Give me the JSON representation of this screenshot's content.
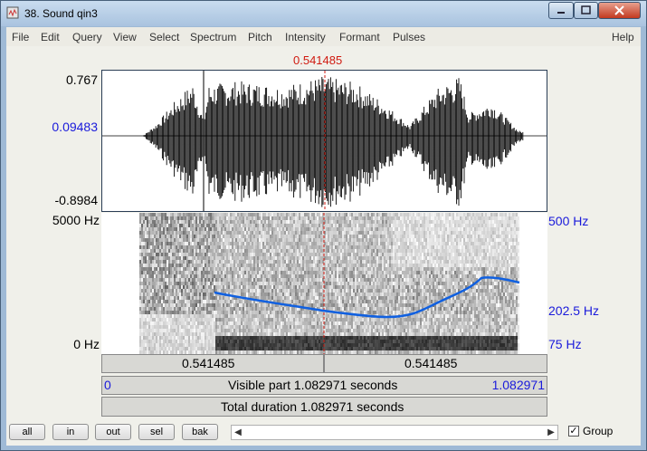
{
  "window": {
    "title": "38. Sound qin3"
  },
  "menu": [
    "File",
    "Edit",
    "Query",
    "View",
    "Select",
    "Spectrum",
    "Pitch",
    "Intensity",
    "Formant",
    "Pulses",
    "Help"
  ],
  "cursor_time": "0.541485",
  "waveform": {
    "ymax": "0.767",
    "ymid": "0.09483",
    "ymin": "-0.8984"
  },
  "spectrogram": {
    "fmax": "5000 Hz",
    "fmin": "0 Hz",
    "pitch_max": "500 Hz",
    "pitch_mid": "202.5 Hz",
    "pitch_min": "75 Hz"
  },
  "time_bar": {
    "left": "0.541485",
    "right": "0.541485"
  },
  "visible_bar": {
    "start": "0",
    "label": "Visible part 1.082971 seconds",
    "end": "1.082971"
  },
  "total_bar": {
    "label": "Total duration 1.082971 seconds"
  },
  "buttons": {
    "all": "all",
    "in": "in",
    "out": "out",
    "sel": "sel",
    "bak": "bak"
  },
  "group_label": "Group",
  "colors": {
    "cursor": "#d01a10",
    "pitch": "#1060e0",
    "axis_blue": "#1a1adb"
  }
}
